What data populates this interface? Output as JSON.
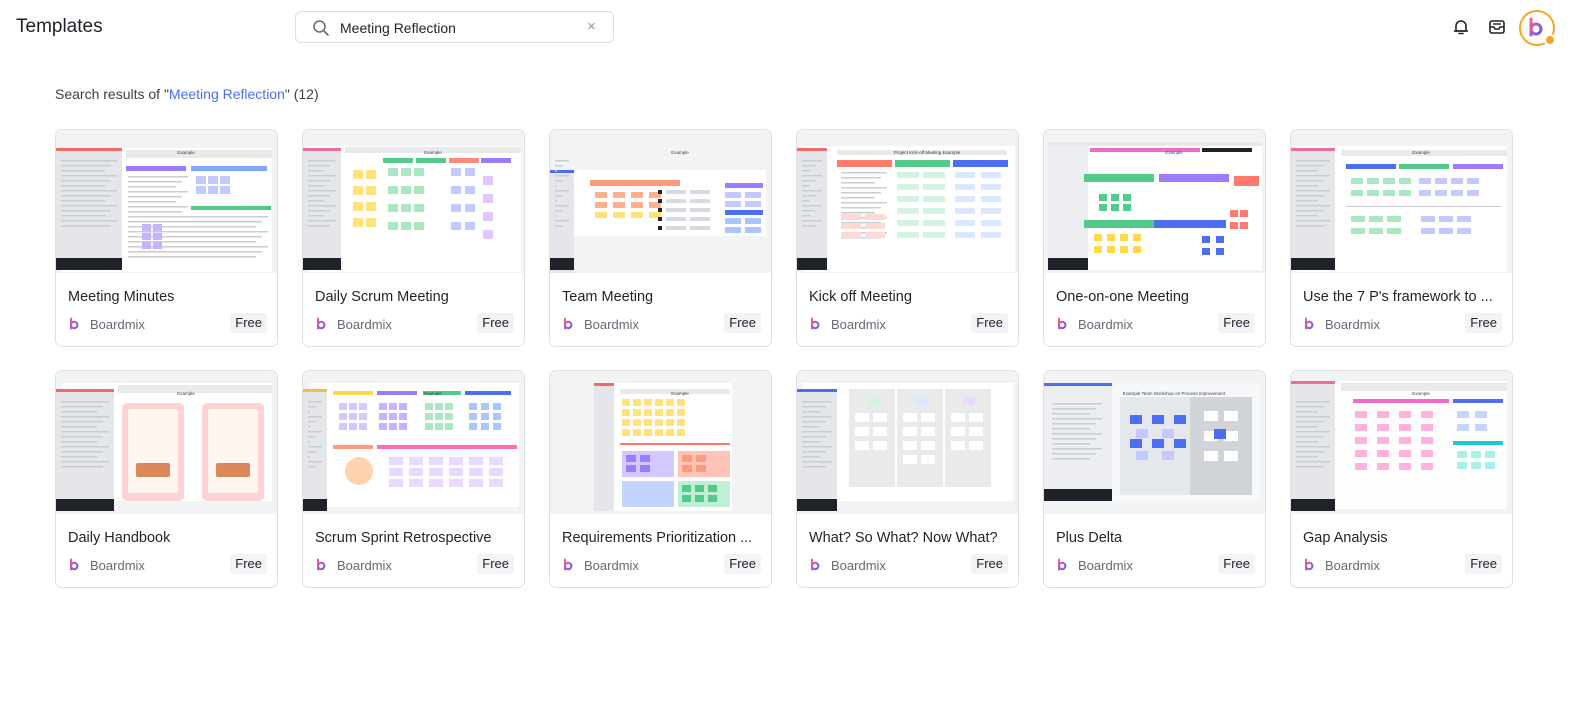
{
  "header": {
    "title": "Templates",
    "search_value": "Meeting Reflection",
    "search_clear": "×",
    "icons": [
      "search-icon",
      "bell-icon",
      "inbox-icon",
      "avatar"
    ]
  },
  "results": {
    "prefix": "Search results of \"",
    "query": "Meeting Reflection",
    "suffix": "\" (12)"
  },
  "colors": {
    "accent": "#4e6ef2",
    "avatar_ring": "#f5a623",
    "brand_gradient_start": "#ff5a8a",
    "brand_gradient_end": "#5a5cff"
  },
  "templates": [
    {
      "title": "Meeting Minutes",
      "brand": "Boardmix",
      "badge": "Free",
      "thumb_label": "Example"
    },
    {
      "title": "Daily Scrum Meeting",
      "brand": "Boardmix",
      "badge": "Free",
      "thumb_label": "Example"
    },
    {
      "title": "Team Meeting",
      "brand": "Boardmix",
      "badge": "Free",
      "thumb_label": "Example"
    },
    {
      "title": "Kick off Meeting",
      "brand": "Boardmix",
      "badge": "Free",
      "thumb_label": "Project Kick-off Meeting Example"
    },
    {
      "title": "One-on-one Meeting",
      "brand": "Boardmix",
      "badge": "Free",
      "thumb_label": "Example"
    },
    {
      "title": "Use the 7 P's framework to ...",
      "brand": "Boardmix",
      "badge": "Free",
      "thumb_label": "Example"
    },
    {
      "title": "Daily Handbook",
      "brand": "Boardmix",
      "badge": "Free",
      "thumb_label": "Example"
    },
    {
      "title": "Scrum Sprint Retrospective",
      "brand": "Boardmix",
      "badge": "Free",
      "thumb_label": "Example"
    },
    {
      "title": "Requirements Prioritization ...",
      "brand": "Boardmix",
      "badge": "Free",
      "thumb_label": "Example"
    },
    {
      "title": "What? So What? Now What?",
      "brand": "Boardmix",
      "badge": "Free",
      "thumb_label": ""
    },
    {
      "title": "Plus Delta",
      "brand": "Boardmix",
      "badge": "Free",
      "thumb_label": "Example Team Workshop on Process Improvement"
    },
    {
      "title": "Gap Analysis",
      "brand": "Boardmix",
      "badge": "Free",
      "thumb_label": "Example"
    }
  ]
}
